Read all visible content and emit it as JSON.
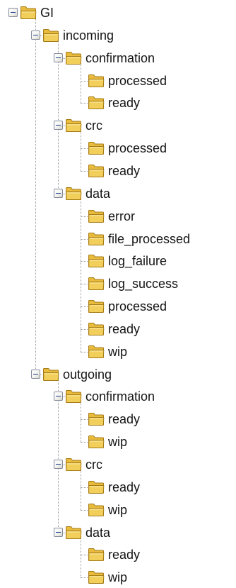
{
  "tree": {
    "label": "GI",
    "expanded": true,
    "children": [
      {
        "label": "incoming",
        "expanded": true,
        "children": [
          {
            "label": "confirmation",
            "expanded": true,
            "children": [
              {
                "label": "processed"
              },
              {
                "label": "ready"
              }
            ]
          },
          {
            "label": "crc",
            "expanded": true,
            "children": [
              {
                "label": "processed"
              },
              {
                "label": "ready"
              }
            ]
          },
          {
            "label": "data",
            "expanded": true,
            "children": [
              {
                "label": "error"
              },
              {
                "label": "file_processed"
              },
              {
                "label": "log_failure"
              },
              {
                "label": "log_success"
              },
              {
                "label": "processed"
              },
              {
                "label": "ready"
              },
              {
                "label": "wip"
              }
            ]
          }
        ]
      },
      {
        "label": "outgoing",
        "expanded": true,
        "children": [
          {
            "label": "confirmation",
            "expanded": true,
            "children": [
              {
                "label": "ready"
              },
              {
                "label": "wip"
              }
            ]
          },
          {
            "label": "crc",
            "expanded": true,
            "children": [
              {
                "label": "ready"
              },
              {
                "label": "wip"
              }
            ]
          },
          {
            "label": "data",
            "expanded": true,
            "children": [
              {
                "label": "ready"
              },
              {
                "label": "wip"
              }
            ]
          }
        ]
      }
    ]
  },
  "colors": {
    "folder_fill": "#f2cf5b",
    "folder_tab": "#e8bb3c",
    "folder_outline": "#a57b17",
    "tree_line": "#9b9b9b",
    "text": "#141414"
  },
  "icons": {
    "folder": "folder-icon",
    "collapse": "collapse-toggle-icon"
  }
}
